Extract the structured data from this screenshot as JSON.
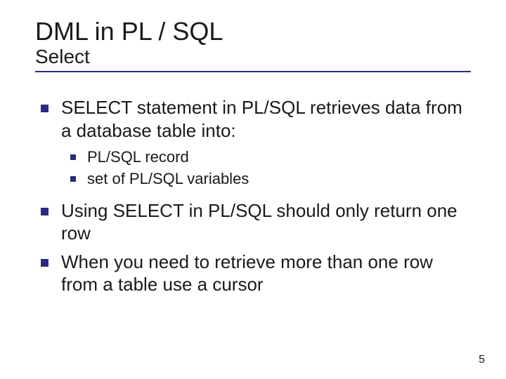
{
  "title": "DML in PL / SQL",
  "subtitle": "Select",
  "bullets": {
    "b1": "SELECT statement in PL/SQL retrieves data from a database table into:",
    "b1_1": "PL/SQL record",
    "b1_2": "set of PL/SQL variables",
    "b2": "Using SELECT in PL/SQL should only return one row",
    "b3": "When you need to retrieve more than one row from a table use a cursor"
  },
  "page_number": "5"
}
